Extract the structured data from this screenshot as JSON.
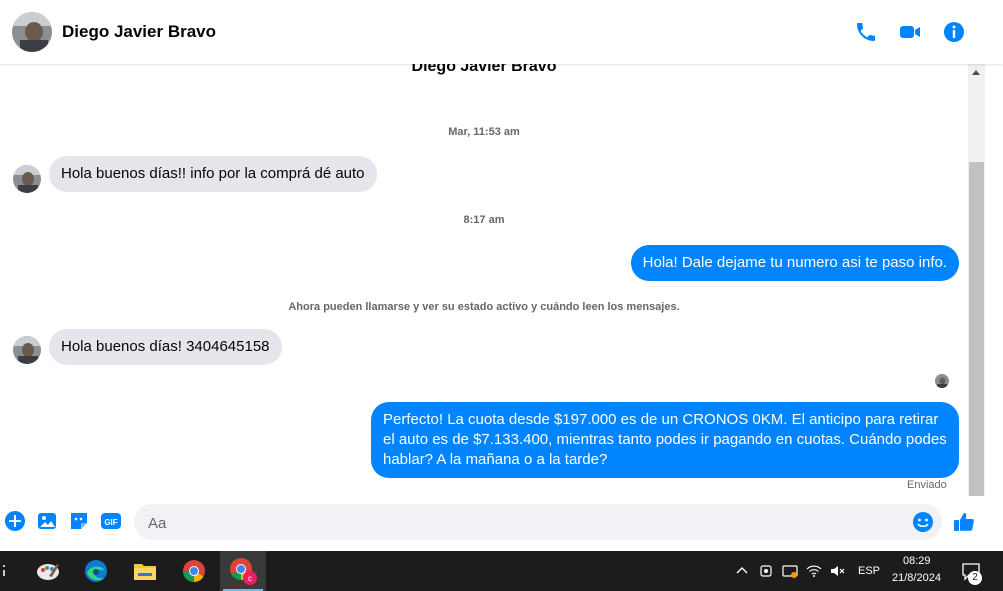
{
  "header": {
    "contact_name": "Diego Javier Bravo",
    "icons": [
      "phone-icon",
      "video-call-icon",
      "info-icon"
    ],
    "accent_color": "#0084ff"
  },
  "chat": {
    "top_name": "Diego Javier Bravo",
    "timestamps": [
      "Mar, 11:53 am",
      "8:17 am"
    ],
    "system_message": "Ahora pueden llamarse y ver su estado activo y cuándo leen los mensajes.",
    "messages": [
      {
        "direction": "in",
        "text": "Hola buenos días!! info por la comprá dé auto"
      },
      {
        "direction": "out",
        "text": "Hola! Dale dejame tu numero  asi te paso info."
      },
      {
        "direction": "in",
        "text": "Hola buenos días! 3404645158"
      },
      {
        "direction": "out",
        "text": "Perfecto! La cuota desde $197.000 es de un CRONOS 0KM. El anticipo para retirar el auto es de $7.133.400, mientras tanto podes ir pagando en cuotas. Cuándo podes hablar? A la mañana o a la tarde?"
      }
    ],
    "status": "Enviado",
    "bubble_in_color": "#e4e6eb",
    "bubble_out_color": "#0084ff"
  },
  "composer": {
    "placeholder": "Aa",
    "icons": [
      "add-icon",
      "photo-icon",
      "sticker-icon",
      "gif-icon",
      "emoji-icon",
      "like-icon"
    ],
    "gif_label": "GIF"
  },
  "taskbar": {
    "apps": [
      "paint-app-icon",
      "edge-browser-icon",
      "file-explorer-icon",
      "chrome-browser-icon",
      "chrome-profile-icon"
    ],
    "language": "ESP",
    "time": "08:29",
    "date": "21/8/2024",
    "notification_count": "2"
  }
}
